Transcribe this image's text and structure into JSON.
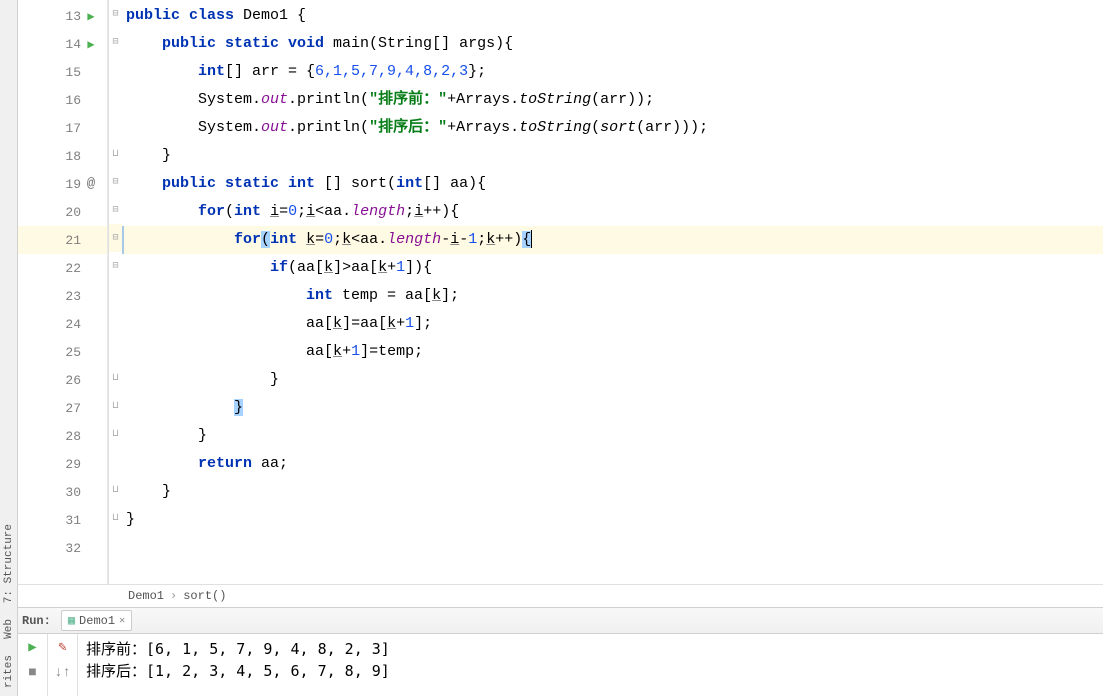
{
  "gutter": {
    "lines": [
      {
        "num": "13",
        "icon": "run"
      },
      {
        "num": "14",
        "icon": "run"
      },
      {
        "num": "15",
        "icon": ""
      },
      {
        "num": "16",
        "icon": ""
      },
      {
        "num": "17",
        "icon": ""
      },
      {
        "num": "18",
        "icon": ""
      },
      {
        "num": "19",
        "icon": "at"
      },
      {
        "num": "20",
        "icon": ""
      },
      {
        "num": "21",
        "icon": "bulb"
      },
      {
        "num": "22",
        "icon": ""
      },
      {
        "num": "23",
        "icon": ""
      },
      {
        "num": "24",
        "icon": ""
      },
      {
        "num": "25",
        "icon": ""
      },
      {
        "num": "26",
        "icon": ""
      },
      {
        "num": "27",
        "icon": ""
      },
      {
        "num": "28",
        "icon": ""
      },
      {
        "num": "29",
        "icon": ""
      },
      {
        "num": "30",
        "icon": ""
      },
      {
        "num": "31",
        "icon": ""
      },
      {
        "num": "32",
        "icon": ""
      }
    ]
  },
  "code": {
    "l13": {
      "kw1": "public class ",
      "id": "Demo1 {"
    },
    "l14": {
      "kw1": "public static void ",
      "id": "main(String[] args){"
    },
    "l15": {
      "kw1": "int",
      "t1": "[] arr = {",
      "nums": "6,1,5,7,9,4,8,2,3",
      "t2": "};"
    },
    "l16": {
      "t1": "System.",
      "f": "out",
      "t2": ".println(",
      "s": "\"排序前：\"",
      "t3": "+Arrays.",
      "m": "toString",
      "t4": "(arr));"
    },
    "l17": {
      "t1": "System.",
      "f": "out",
      "t2": ".println(",
      "s": "\"排序后：\"",
      "t3": "+Arrays.",
      "m": "toString",
      "t4": "(",
      "m2": "sort",
      "t5": "(arr)));"
    },
    "l18": {
      "t": "}"
    },
    "l19": {
      "kw1": "public static int ",
      "t": "[] sort(",
      "kw2": "int",
      "t2": "[] aa){"
    },
    "l20": {
      "kw1": "for",
      "t1": "(",
      "kw2": "int ",
      "v": "i",
      "t2": "=",
      "n": "0",
      "t3": ";",
      "v2": "i",
      "t4": "<aa.",
      "f": "length",
      "t5": ";",
      "v3": "i",
      "t6": "++){"
    },
    "l21": {
      "kw1": "for",
      "t1": "(",
      "kw2": "int ",
      "v": "k",
      "t2": "=",
      "n": "0",
      "t3": ";",
      "v2": "k",
      "t4": "<aa.",
      "f": "length",
      "t5": "-",
      "v3": "i",
      "t6": "-",
      "n2": "1",
      "t7": ";",
      "v4": "k",
      "t8": "++)",
      "brace": "{"
    },
    "l22": {
      "kw1": "if",
      "t1": "(aa[",
      "v": "k",
      "t2": "]>aa[",
      "v2": "k",
      "t3": "+",
      "n": "1",
      "t4": "]){"
    },
    "l23": {
      "kw1": "int ",
      "t1": "temp = aa[",
      "v": "k",
      "t2": "];"
    },
    "l24": {
      "t1": "aa[",
      "v": "k",
      "t2": "]=aa[",
      "v2": "k",
      "t3": "+",
      "n": "1",
      "t4": "];"
    },
    "l25": {
      "t1": "aa[",
      "v": "k",
      "t2": "+",
      "n": "1",
      "t3": "]=temp;"
    },
    "l26": {
      "t": "}"
    },
    "l27": {
      "brace": "}"
    },
    "l28": {
      "t": "}"
    },
    "l29": {
      "kw1": "return ",
      "t": "aa;"
    },
    "l30": {
      "t": "}"
    },
    "l31": {
      "t": "}"
    }
  },
  "crumbs": {
    "c1": "Demo1",
    "sep": "›",
    "c2": "sort()"
  },
  "run": {
    "label": "Run:",
    "tab": "Demo1"
  },
  "console": {
    "line1": "排序前：[6, 1, 5, 7, 9, 4, 8, 2, 3]",
    "line2": "排序后：[1, 2, 3, 4, 5, 6, 7, 8, 9]"
  },
  "sidebar": {
    "structure": "7: Structure",
    "web": "Web",
    "favorites": "rites"
  }
}
